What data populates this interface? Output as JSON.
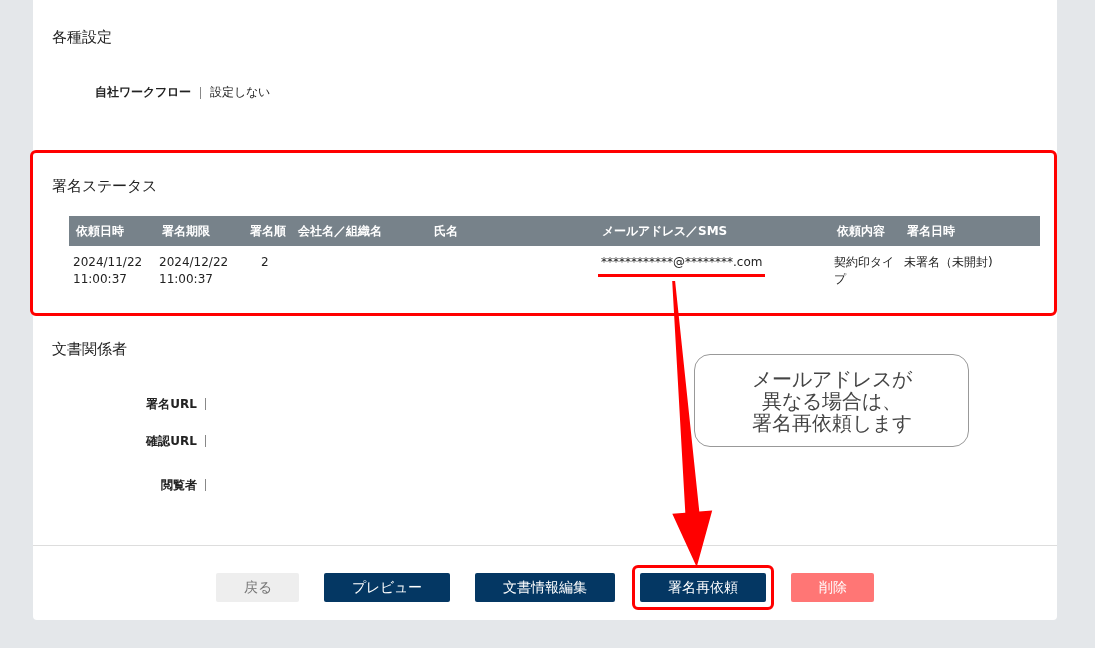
{
  "settings": {
    "title": "各種設定",
    "fields": [
      {
        "label": "自社ワークフロー",
        "value": "設定しない"
      }
    ]
  },
  "signing_status": {
    "title": "署名ステータス",
    "annotated": true,
    "columns": [
      "依頼日時",
      "署名期限",
      "署名順",
      "会社名／組織名",
      "氏名",
      "メールアドレス／SMS",
      "依頼内容",
      "署名日時"
    ],
    "rows": [
      {
        "cells": [
          "2024/11/22 11:00:37",
          "2024/12/22 11:00:37",
          "2",
          null,
          null,
          "************@********.com",
          "契約印タイプ",
          "未署名（未開封)"
        ],
        "email_underlined": true
      }
    ]
  },
  "document_parties": {
    "title": "文書関係者",
    "fields": [
      {
        "label": "署名URL"
      },
      {
        "label": "確認URL"
      },
      {
        "label": "閲覧者"
      }
    ]
  },
  "buttons": [
    {
      "label": "戻る",
      "kind": "secondary",
      "annotated": false
    },
    {
      "label": "プレビュー",
      "kind": "primary",
      "annotated": false
    },
    {
      "label": "文書情報編集",
      "kind": "primary",
      "annotated": false
    },
    {
      "label": "署名再依頼",
      "kind": "primary",
      "annotated": true
    },
    {
      "label": "削除",
      "kind": "danger",
      "annotated": false
    }
  ],
  "callout": {
    "lines": [
      "メールアドレスが",
      "異なる場合は、",
      "署名再依頼します"
    ]
  }
}
